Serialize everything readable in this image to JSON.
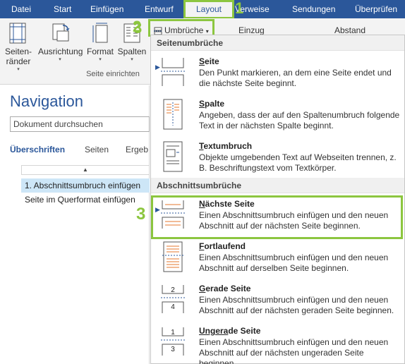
{
  "tabs": [
    "Datei",
    "Start",
    "Einfügen",
    "Entwurf",
    "Layout",
    "Verweise",
    "Sendungen",
    "Überprüfen"
  ],
  "callouts": [
    "1",
    "2",
    "3"
  ],
  "ribbon": {
    "buttons": [
      {
        "line1": "Seiten-",
        "line2": "ränder",
        "icon": "margins-icon"
      },
      {
        "line1": "Ausrichtung",
        "line2": "",
        "icon": "orientation-icon"
      },
      {
        "line1": "Format",
        "line2": "",
        "icon": "size-icon"
      },
      {
        "line1": "Spalten",
        "line2": "",
        "icon": "columns-icon"
      }
    ],
    "dropdown_arrow": "▾",
    "group_label": "Seite einrichten",
    "breaks_label": "Umbrüche",
    "indent_label": "Einzug",
    "spacing_label": "Abstand"
  },
  "navigation": {
    "title": "Navigation",
    "search_value": "Dokument durchsuchen",
    "tabs": [
      "Überschriften",
      "Seiten",
      "Ergeb"
    ],
    "scroll_glyph": "▲",
    "items": [
      "1. Abschnittsumbruch einfügen",
      "Seite im Querformat einfügen"
    ]
  },
  "menu": {
    "section_page": "Seitenumbrüche",
    "section_section": "Abschnittsumbrüche",
    "items": [
      {
        "title_u": "S",
        "title_rest": "eite",
        "desc": "Den Punkt markieren, an dem eine Seite endet und die nächste Seite beginnt.",
        "icon": "page-break-icon"
      },
      {
        "title_u": "S",
        "title_rest": "palte",
        "desc": "Angeben, dass der auf den Spaltenumbruch folgende Text in der nächsten Spalte beginnt.",
        "icon": "column-break-icon"
      },
      {
        "title_u": "T",
        "title_rest": "extumbruch",
        "desc": "Objekte umgebenden Text auf Webseiten trennen, z. B. Beschriftungstext vom Textkörper.",
        "icon": "text-wrapping-icon"
      },
      {
        "title_u": "N",
        "title_rest": "ächste Seite",
        "desc": "Einen Abschnittsumbruch einfügen und den neuen Abschnitt auf der nächsten Seite beginnen.",
        "icon": "next-page-icon"
      },
      {
        "title_u": "F",
        "title_rest": "ortlaufend",
        "desc": "Einen Abschnittsumbruch einfügen und den neuen Abschnitt auf derselben Seite beginnen.",
        "icon": "continuous-icon"
      },
      {
        "title_u": "G",
        "title_rest": "erade Seite",
        "desc": "Einen Abschnittsumbruch einfügen und den neuen Abschnitt auf der nächsten geraden Seite beginnen.",
        "icon": "even-page-icon"
      },
      {
        "title_u": "Ungera",
        "title_rest": "de Seite",
        "desc": "Einen Abschnittsumbruch einfügen und den neuen Abschnitt auf der nächsten ungeraden Seite beginnen.",
        "icon": "odd-page-icon"
      }
    ],
    "even_icon_nums": [
      "2",
      "4"
    ],
    "odd_icon_nums": [
      "1",
      "3"
    ]
  },
  "colors": {
    "accent": "#2b579a",
    "callout": "#8cc63f",
    "orange": "#e6772e"
  }
}
